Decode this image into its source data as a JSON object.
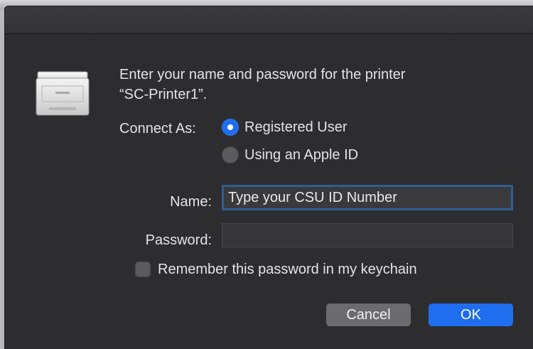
{
  "dialog": {
    "message_line1": "Enter your name and password for the printer",
    "message_line2": "“SC-Printer1”."
  },
  "connect_as": {
    "label": "Connect As:",
    "options": [
      {
        "label": "Registered User",
        "selected": true
      },
      {
        "label": "Using an Apple ID",
        "selected": false
      }
    ]
  },
  "fields": {
    "name_label": "Name:",
    "name_value": "Type your CSU ID Number",
    "password_label": "Password:",
    "password_value": ""
  },
  "remember": {
    "label": "Remember this password in my keychain",
    "checked": false
  },
  "buttons": {
    "cancel_label": "Cancel",
    "ok_label": "OK"
  },
  "colors": {
    "accent": "#1f6ef0",
    "dialog_background": "#2d2d2f",
    "focus_ring": "#2f5f92"
  },
  "icons": {
    "printer": "printer-icon"
  }
}
